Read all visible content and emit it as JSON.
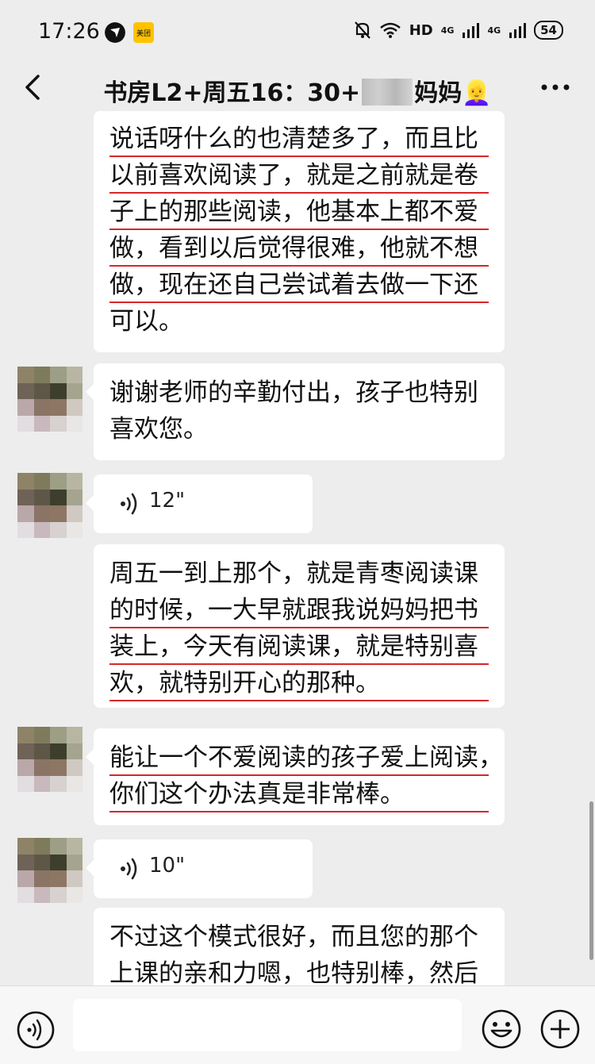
{
  "status_bar": {
    "time": "17:26",
    "app_badge": "美团",
    "network_hd": "HD",
    "network_4g_1": "4G",
    "network_4g_2": "4G",
    "battery": "54"
  },
  "header": {
    "title_prefix": "书房L2+周五16：30+",
    "title_suffix": "妈妈👱‍♀️"
  },
  "messages": [
    {
      "type": "text",
      "lines": [
        {
          "text": "说话呀什么的也清楚多了，而且比",
          "underline": true
        },
        {
          "text": "以前喜欢阅读了，就是之前就是卷",
          "underline": true
        },
        {
          "text": "子上的那些阅读，他基本上都不爱",
          "underline": true
        },
        {
          "text": "做，看到以后觉得很难，他就不想",
          "underline": true
        },
        {
          "text": "做，现在还自己尝试着去做一下还",
          "underline": true
        },
        {
          "text": "可以。",
          "underline": false
        }
      ]
    },
    {
      "type": "text",
      "lines": [
        {
          "text": "谢谢老师的辛勤付出，孩子也特别",
          "underline": false
        },
        {
          "text": "喜欢您。",
          "underline": false
        }
      ]
    },
    {
      "type": "voice",
      "duration": "12\""
    },
    {
      "type": "text",
      "lines": [
        {
          "text": "周五一到上那个，就是青枣阅读课",
          "underline": false
        },
        {
          "text": "的时候，一大早就跟我说妈妈把书",
          "underline": true
        },
        {
          "text": "装上，今天有阅读课，就是特别喜",
          "underline": true
        },
        {
          "text": "欢，就特别开心的那种。",
          "underline": true
        }
      ]
    },
    {
      "type": "text",
      "lines": [
        {
          "text": "能让一个不爱阅读的孩子爱上阅读，",
          "underline": true
        },
        {
          "text": "你们这个办法真是非常棒。",
          "underline": true
        }
      ]
    },
    {
      "type": "voice",
      "duration": "10\""
    },
    {
      "type": "text",
      "lines": [
        {
          "text": "不过这个模式很好，而且您的那个",
          "underline": false
        },
        {
          "text": "上课的亲和力嗯，也特别棒，然后",
          "underline": false
        }
      ]
    }
  ],
  "colors": {
    "background": "#ededed",
    "bubble": "#ffffff",
    "underline": "#d8262a",
    "avatar_tiles": [
      "#8f8367",
      "#7e7b5c",
      "#9c9f85",
      "#b8b6a3",
      "#6f6257",
      "#5e5748",
      "#3d3f2c",
      "#a5a48f",
      "#b9a7aa",
      "#8a7466",
      "#8d7663",
      "#cfc9c2",
      "#e2dde0",
      "#c9b8bd",
      "#d7d2cf",
      "#e9e6e6"
    ]
  },
  "input_bar": {
    "voice_icon": "voice-toggle-icon",
    "emoji_icon": "emoji-icon",
    "add_icon": "plus-circle-icon"
  }
}
